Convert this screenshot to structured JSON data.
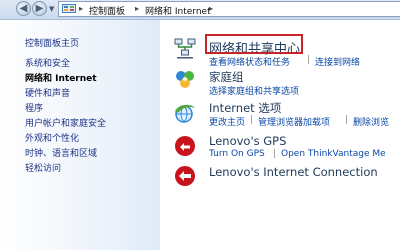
{
  "address_bar": {
    "crumbs": [
      "控制面板",
      "网络和 Internet"
    ],
    "nav_icons": [
      "back-arrow-icon",
      "forward-arrow-icon",
      "recent-pages-dropdown-icon"
    ],
    "folder_icon": "control-panel-icon"
  },
  "sidebar": {
    "items": [
      {
        "label": "控制面板主页"
      },
      {
        "label": "系统和安全"
      },
      {
        "label": "网络和 Internet",
        "current": true
      },
      {
        "label": "硬件和声音"
      },
      {
        "label": "程序"
      },
      {
        "label": "用户帐户和家庭安全"
      },
      {
        "label": "外观和个性化"
      },
      {
        "label": "时钟、语言和区域"
      },
      {
        "label": "轻松访问"
      }
    ]
  },
  "main": {
    "categories": [
      {
        "title": "网络和共享中心",
        "icon": "network-sharing-center-icon",
        "highlighted": true,
        "tasks": [
          "查看网络状态和任务",
          "连接到网络"
        ]
      },
      {
        "title": "家庭组",
        "icon": "homegroup-icon",
        "tasks": [
          "选择家庭组和共享选项"
        ]
      },
      {
        "title": "Internet 选项",
        "icon": "internet-options-icon",
        "tasks": [
          "更改主页",
          "管理浏览器加载项",
          "删除浏览"
        ]
      },
      {
        "title": "Lenovo's GPS",
        "icon": "lenovo-gps-icon",
        "tasks": [
          "Turn On GPS",
          "Open ThinkVantage Me"
        ]
      },
      {
        "title": "Lenovo's Internet Connection",
        "icon": "lenovo-internet-connection-icon",
        "tasks": []
      }
    ]
  },
  "colors": {
    "link": "#0b48a7",
    "category_title": "#1e395b",
    "sidebar_link": "#1e3287",
    "highlight_box": "#c6262a"
  }
}
